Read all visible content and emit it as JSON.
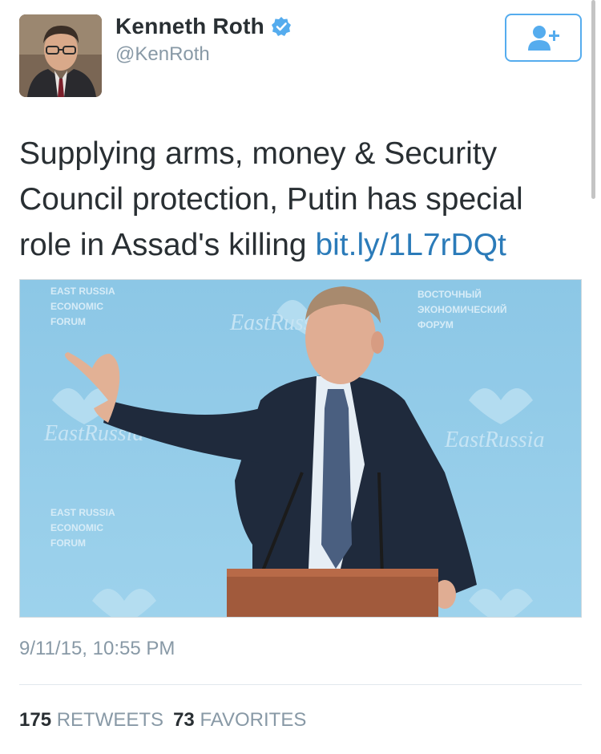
{
  "author": {
    "display_name": "Kenneth Roth",
    "handle": "@KenRoth",
    "verified": true,
    "avatar_icon": "profile-photo"
  },
  "follow_button": {
    "icon": "add-user-icon",
    "color": "#55acee"
  },
  "tweet": {
    "text": "Supplying arms, money & Security Council protection, Putin has special role in Assad's killing ",
    "link_text": "bit.ly/1L7rDQt",
    "link_color": "#2b7bb9"
  },
  "media": {
    "backdrop_text": {
      "left_top": [
        "EAST RUSSIA",
        "ECONOMIC",
        "FORUM"
      ],
      "right_top": [
        "ВОСТОЧНЫЙ",
        "ЭКОНОМИЧЕСКИЙ",
        "ФОРУМ"
      ],
      "left_bottom": [
        "EAST RUSSIA",
        "ECONOMIC",
        "FORUM"
      ],
      "logo_word": "EastRussia"
    }
  },
  "timestamp": "9/11/15, 10:55 PM",
  "stats": {
    "retweets_count": "175",
    "retweets_label": "RETWEETS",
    "favorites_count": "73",
    "favorites_label": "FAVORITES"
  }
}
